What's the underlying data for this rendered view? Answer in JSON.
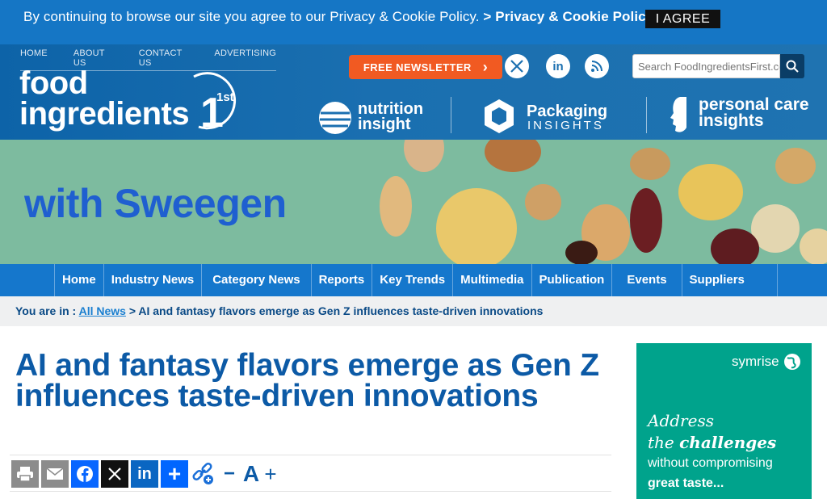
{
  "cookie": {
    "message": "By continuing to browse our site you agree to our Privacy & Cookie Policy.",
    "policy_link": "> Privacy & Cookie Policy",
    "agree_label": "I AGREE"
  },
  "topnav": [
    "HOME",
    "ABOUT US",
    "CONTACT US",
    "ADVERTISING"
  ],
  "logo": {
    "line1": "food",
    "line2": "ingredients",
    "sup": "1st"
  },
  "newsletter": {
    "label": "FREE NEWSLETTER",
    "arrow": "›"
  },
  "social": {
    "x": "𝕏",
    "linkedin": "in",
    "rss": "rss-icon"
  },
  "search": {
    "placeholder": "Search FoodIngredientsFirst.com"
  },
  "partners": {
    "nutrition": {
      "line1": "nutrition",
      "line2": "insight"
    },
    "packaging": {
      "line1": "Packaging",
      "line2": "INSIGHTS"
    },
    "personal": {
      "line1": "personal care",
      "line2": "insights"
    }
  },
  "banner": {
    "text": "with Sweegen"
  },
  "mainnav": [
    "Home",
    "Industry News",
    "Category News",
    "Reports",
    "Key Trends",
    "Multimedia",
    "Publication",
    "Events",
    "Suppliers"
  ],
  "breadcrumb": {
    "prefix": "You are in :",
    "link": "All News",
    "current": "> AI and fantasy flavors emerge as Gen Z influences taste-driven innovations"
  },
  "article": {
    "title": "AI and fantasy flavors emerge as Gen Z influences taste-driven innovations"
  },
  "share": {
    "font_minus": "−",
    "font_a": "A",
    "font_plus": "+"
  },
  "ad": {
    "brand": "symrise",
    "line1": "Address",
    "line2_pre": "the ",
    "line2_bold": "challenges",
    "line3": "without compromising",
    "line4": "great taste..."
  },
  "colors": {
    "brand_blue": "#1577cc",
    "header_blue": "#1a6fb0",
    "orange": "#f15a22",
    "ad_teal": "#00a38c",
    "headline": "#0c5aa6"
  }
}
